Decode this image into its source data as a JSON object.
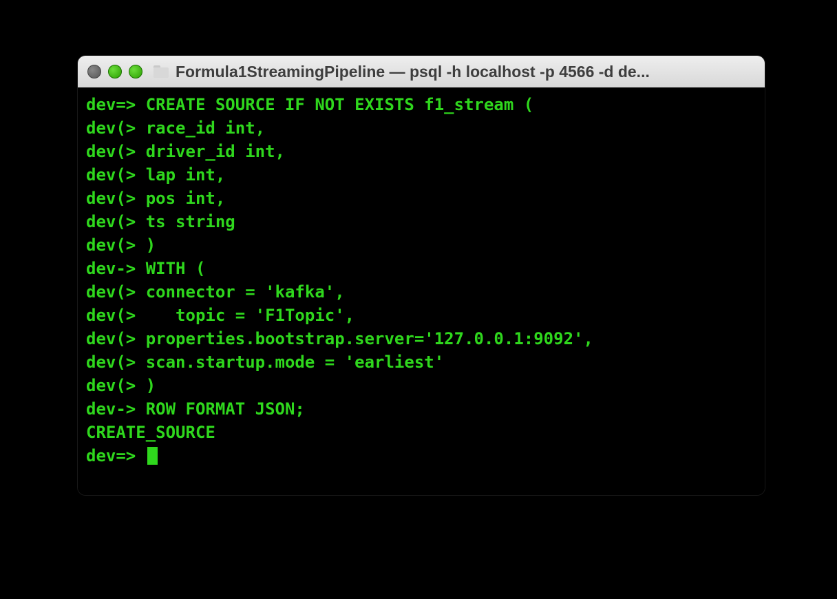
{
  "window": {
    "title": "Formula1StreamingPipeline — psql -h localhost -p 4566 -d de..."
  },
  "terminal": {
    "lines": [
      "dev=> CREATE SOURCE IF NOT EXISTS f1_stream (",
      "dev(> race_id int,",
      "dev(> driver_id int,",
      "dev(> lap int,",
      "dev(> pos int,",
      "dev(> ts string",
      "dev(> )",
      "dev-> WITH (",
      "dev(> connector = 'kafka',",
      "dev(>    topic = 'F1Topic',",
      "dev(> properties.bootstrap.server='127.0.0.1:9092',",
      "dev(> scan.startup.mode = 'earliest'",
      "dev(> )",
      "dev-> ROW FORMAT JSON;",
      "CREATE_SOURCE"
    ],
    "prompt": "dev=> "
  },
  "colors": {
    "terminal_text": "#2fd71d",
    "terminal_bg": "#000000",
    "titlebar_bg": "#e0e0e0"
  }
}
